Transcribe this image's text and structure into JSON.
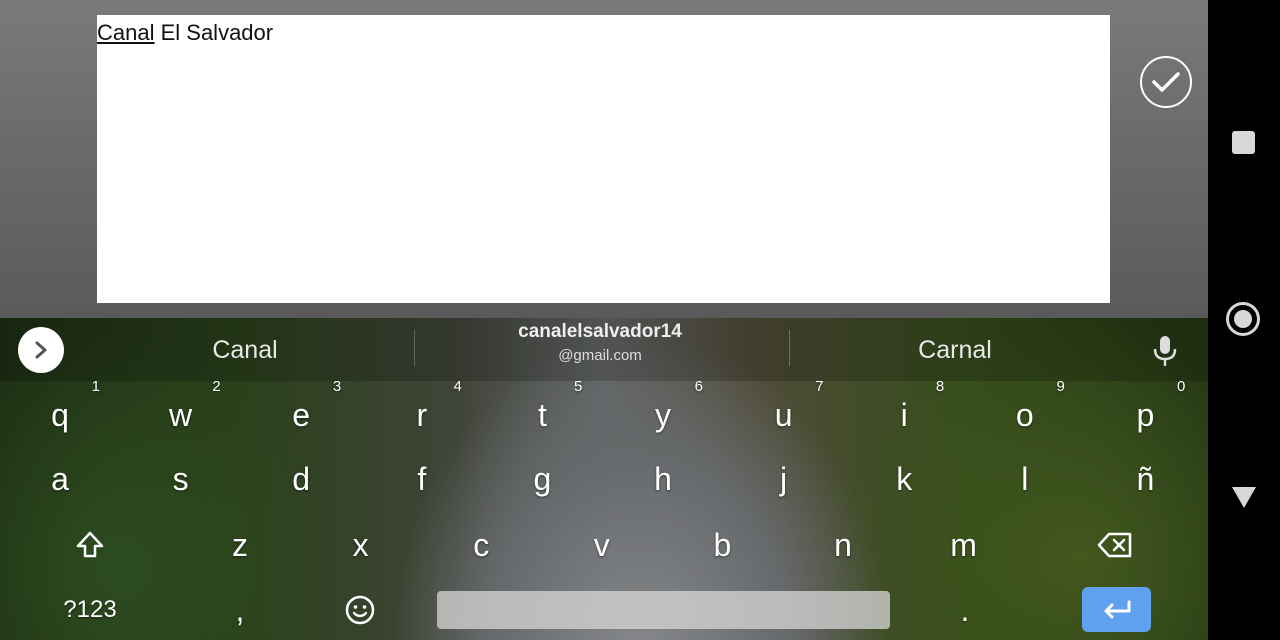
{
  "editor": {
    "composing_word": "Canal",
    "rest_text": " El Salvador"
  },
  "suggestions": {
    "left": "Canal",
    "middle_line1": "canalelsalvador14",
    "middle_line2": "@gmail.com",
    "right": "Carnal"
  },
  "keyboard": {
    "row1": [
      {
        "label": "q",
        "hint": "1"
      },
      {
        "label": "w",
        "hint": "2"
      },
      {
        "label": "e",
        "hint": "3"
      },
      {
        "label": "r",
        "hint": "4"
      },
      {
        "label": "t",
        "hint": "5"
      },
      {
        "label": "y",
        "hint": "6"
      },
      {
        "label": "u",
        "hint": "7"
      },
      {
        "label": "i",
        "hint": "8"
      },
      {
        "label": "o",
        "hint": "9"
      },
      {
        "label": "p",
        "hint": "0"
      }
    ],
    "row2": [
      "a",
      "s",
      "d",
      "f",
      "g",
      "h",
      "j",
      "k",
      "l",
      "ñ"
    ],
    "row3": [
      "z",
      "x",
      "c",
      "v",
      "b",
      "n",
      "m"
    ],
    "symbols_label": "?123",
    "comma_label": ",",
    "period_label": "."
  },
  "colors": {
    "enter_key": "#5fa1ee",
    "space_key": "#d7d7d7"
  }
}
